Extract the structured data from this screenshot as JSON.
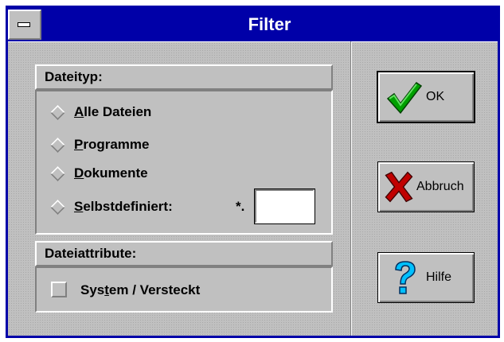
{
  "window": {
    "title": "Filter"
  },
  "file_type_group": {
    "header": "Dateityp:",
    "options": [
      {
        "label": "Alle Dateien",
        "mnemonic": "A",
        "rest": "lle Dateien"
      },
      {
        "label": "Programme",
        "mnemonic": "P",
        "rest": "rogramme"
      },
      {
        "label": "Dokumente",
        "mnemonic": "D",
        "rest": "okumente"
      },
      {
        "label": "Selbstdefiniert:",
        "mnemonic": "S",
        "rest": "elbstdefiniert:"
      }
    ],
    "custom_prefix": "*.",
    "custom_value": ""
  },
  "attribute_group": {
    "header": "Dateiattribute:",
    "checkbox": {
      "pre": "Sys",
      "mnemonic": "t",
      "post": "em / Versteckt",
      "checked": false
    }
  },
  "buttons": {
    "ok": "OK",
    "cancel": "Abbruch",
    "help": "Hilfe"
  },
  "icons": {
    "ok": "checkmark-icon",
    "cancel": "red-x-icon",
    "help": "question-mark-icon"
  },
  "colors": {
    "titlebar": "#0000a8",
    "face": "#c0c0c0",
    "check_green": "#00a000",
    "x_red": "#c00000",
    "help_cyan": "#00c0ff"
  }
}
